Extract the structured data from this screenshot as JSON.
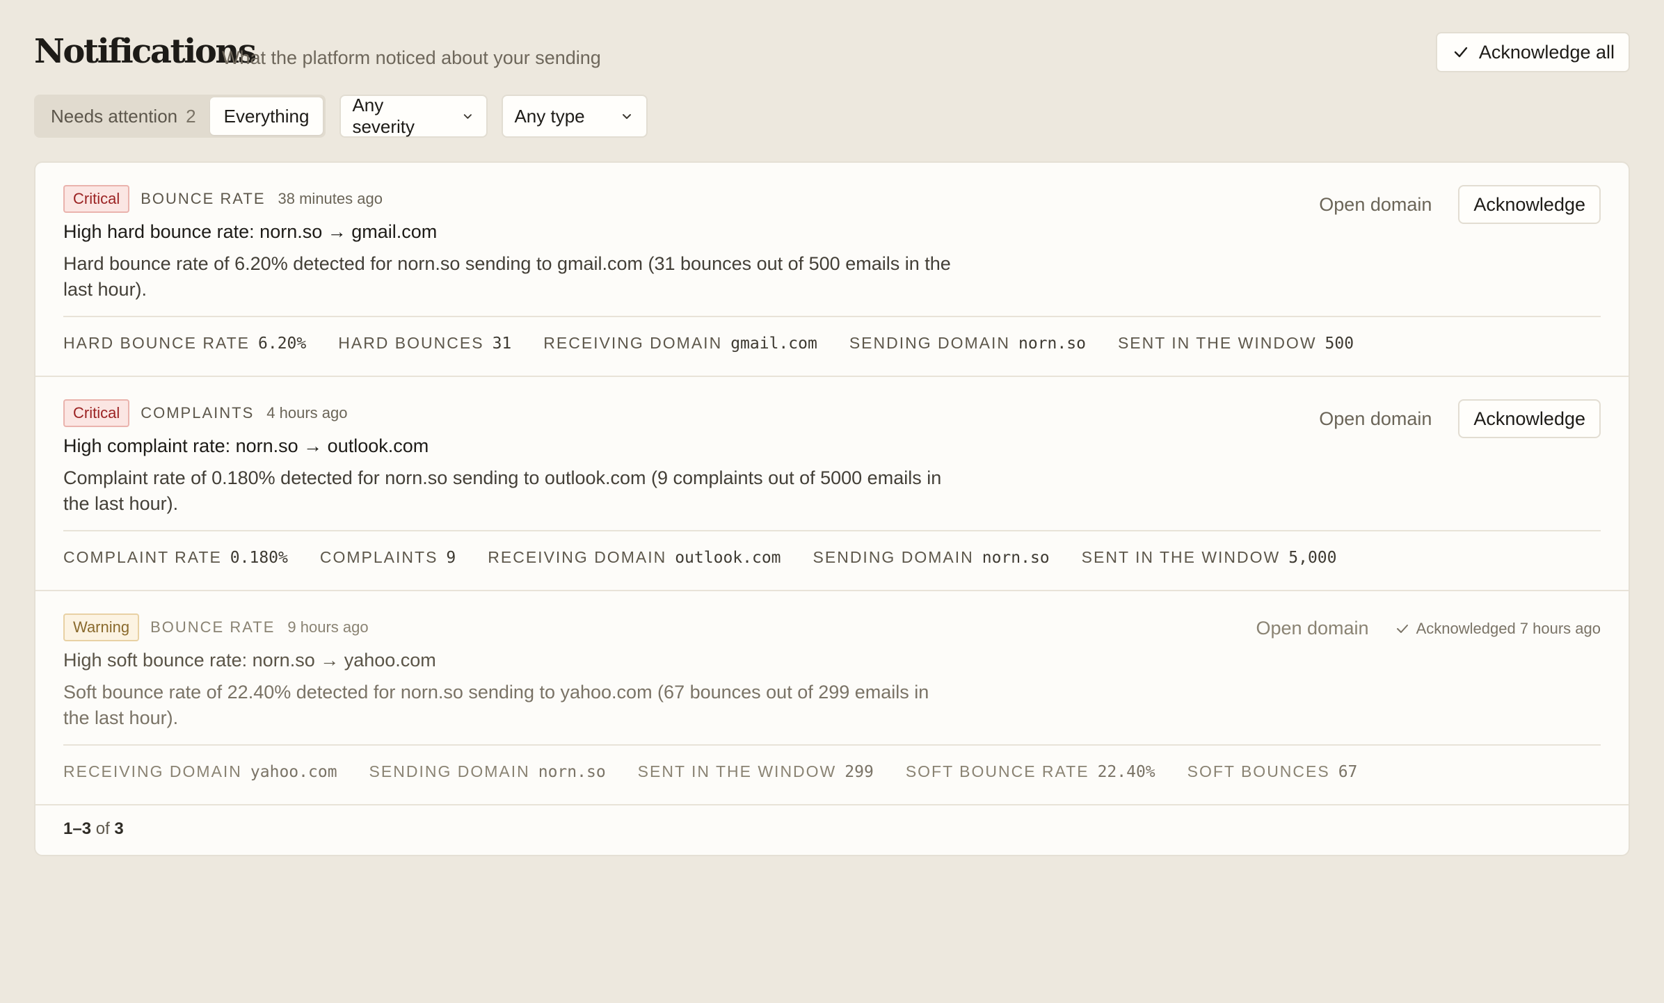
{
  "header": {
    "title": "Notifications",
    "subtitle": "What the platform noticed about your sending",
    "ack_all_label": "Acknowledge all"
  },
  "filters": {
    "segments": [
      {
        "label": "Needs attention",
        "count": "2",
        "active": false
      },
      {
        "label": "Everything",
        "active": true
      }
    ],
    "severity": "Any severity",
    "type": "Any type"
  },
  "notifications": [
    {
      "severity": "Critical",
      "type": "BOUNCE RATE",
      "time": "38 minutes ago",
      "title": "High hard bounce rate: norn.so → gmail.com",
      "description": "Hard bounce rate of 6.20% detected for norn.so sending to gmail.com (31 bounces out of 500 emails in the last hour).",
      "stats": [
        {
          "label": "HARD BOUNCE RATE",
          "value": "6.20%"
        },
        {
          "label": "HARD BOUNCES",
          "value": "31"
        },
        {
          "label": "RECEIVING DOMAIN",
          "value": "gmail.com"
        },
        {
          "label": "SENDING DOMAIN",
          "value": "norn.so"
        },
        {
          "label": "SENT IN THE WINDOW",
          "value": "500"
        }
      ],
      "open_label": "Open domain",
      "ack_label": "Acknowledge"
    },
    {
      "severity": "Critical",
      "type": "COMPLAINTS",
      "time": "4 hours ago",
      "title": "High complaint rate: norn.so → outlook.com",
      "description": "Complaint rate of 0.180% detected for norn.so sending to outlook.com (9 complaints out of 5000 emails in the last hour).",
      "stats": [
        {
          "label": "COMPLAINT RATE",
          "value": "0.180%"
        },
        {
          "label": "COMPLAINTS",
          "value": "9"
        },
        {
          "label": "RECEIVING DOMAIN",
          "value": "outlook.com"
        },
        {
          "label": "SENDING DOMAIN",
          "value": "norn.so"
        },
        {
          "label": "SENT IN THE WINDOW",
          "value": "5,000"
        }
      ],
      "open_label": "Open domain",
      "ack_label": "Acknowledge"
    },
    {
      "severity": "Warning",
      "type": "BOUNCE RATE",
      "time": "9 hours ago",
      "title": "High soft bounce rate: norn.so → yahoo.com",
      "description": "Soft bounce rate of 22.40% detected for norn.so sending to yahoo.com (67 bounces out of 299 emails in the last hour).",
      "stats": [
        {
          "label": "RECEIVING DOMAIN",
          "value": "yahoo.com"
        },
        {
          "label": "SENDING DOMAIN",
          "value": "norn.so"
        },
        {
          "label": "SENT IN THE WINDOW",
          "value": "299"
        },
        {
          "label": "SOFT BOUNCE RATE",
          "value": "22.40%"
        },
        {
          "label": "SOFT BOUNCES",
          "value": "67"
        }
      ],
      "open_label": "Open domain",
      "acknowledged_label": "Acknowledged 7 hours ago"
    }
  ],
  "pagination": {
    "range": "1–3",
    "of": "of",
    "total": "3"
  },
  "colors": {
    "background": "#ede8de",
    "critical": "#9b2323",
    "warning": "#8a6a2d"
  }
}
